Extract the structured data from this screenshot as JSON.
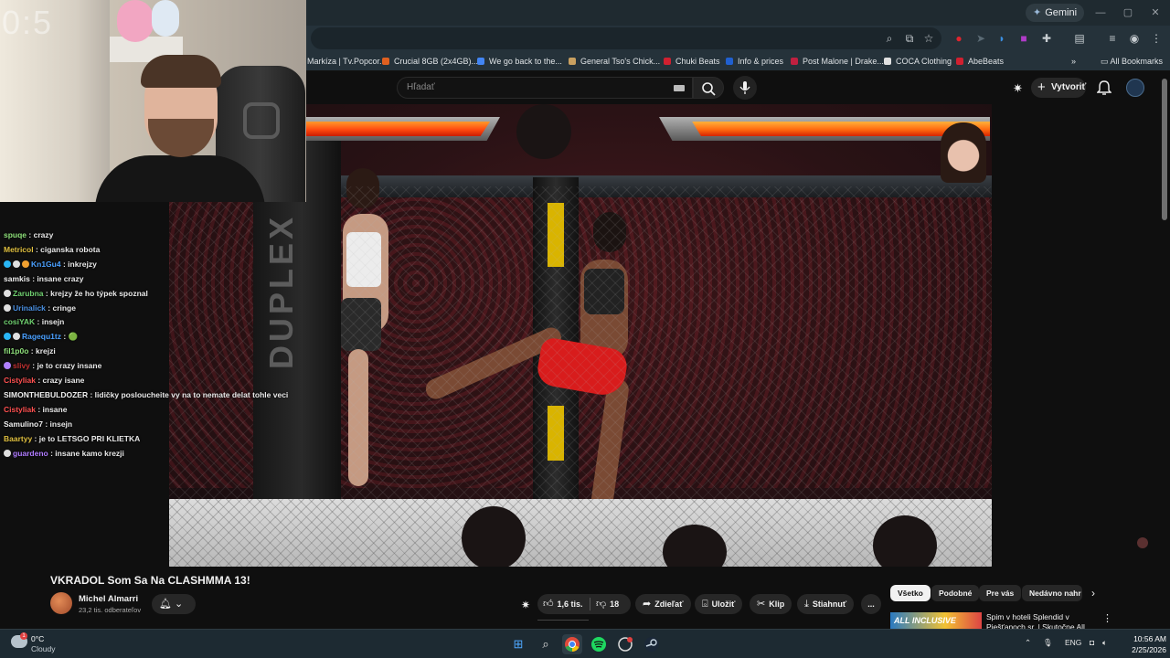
{
  "browser": {
    "gemini_label": "Gemini",
    "bookmarks": [
      {
        "label": "Markíza | Tv.Popcor...",
        "color": "#e0a000"
      },
      {
        "label": "Crucial 8GB (2x4GB)...",
        "color": "#e06020"
      },
      {
        "label": "We go back to the...",
        "color": "#4285f4"
      },
      {
        "label": "General Tso's Chick...",
        "color": "#c9a060"
      },
      {
        "label": "Chuki Beats",
        "color": "#d02030"
      },
      {
        "label": "Info & prices",
        "color": "#2060d0"
      },
      {
        "label": "Post Malone | Drake...",
        "color": "#c02040"
      },
      {
        "label": "COCA Clothing",
        "color": "#222222"
      },
      {
        "label": "AbeBeats",
        "color": "#d02030"
      }
    ],
    "all_bookmarks_label": "All Bookmarks"
  },
  "youtube": {
    "search_placeholder": "Hľadať",
    "create_label": "Vytvoriť",
    "video": {
      "title": "VKRADOL Som Sa Na CLASHMMA 13!",
      "channel": "Michel Almarri",
      "subscribers": "23,2 tis. odberateľov",
      "likes": "1,6 tis.",
      "dislikes": "18",
      "share_label": "Zdieľať",
      "save_label": "Uložiť",
      "clip_label": "Klip",
      "download_label": "Stiahnuť",
      "more_label": "..."
    },
    "chips": [
      {
        "label": "Všetko",
        "active": true
      },
      {
        "label": "Podobné",
        "active": false
      },
      {
        "label": "Pre vás",
        "active": false
      },
      {
        "label": "Nedávno nahr",
        "active": false
      }
    ],
    "recommendation": {
      "thumb_text": "ALL INCLUSIVE",
      "title": "Spim v hoteli Splendid v Piešťanoch sr. | Skutočne All"
    },
    "overlay": {
      "hp_left": 0.97,
      "hp_right": 0.9,
      "pillar_text": "DUPLEX"
    }
  },
  "webcam": {
    "timer": "0:5"
  },
  "chat": [
    {
      "user": "spuqe",
      "color": "#8ee07a",
      "message": "crazy",
      "badges": []
    },
    {
      "user": "Metricol",
      "color": "#e0c040",
      "message": "ciganska robota",
      "badges": []
    },
    {
      "user": "Kn1Gu4",
      "color": "#4aa0ff",
      "message": "inkrejzy",
      "badges": [
        "#29b6f6",
        "#e0e0e0",
        "#f0a030"
      ]
    },
    {
      "user": "samkis",
      "color": "#f0f0f0",
      "message": "insane crazy",
      "badges": []
    },
    {
      "user": "Zarubna",
      "color": "#70d070",
      "message": "krejzy že ho týpek spoznal",
      "badges": [
        "#e0e0e0"
      ]
    },
    {
      "user": "Urinalick",
      "color": "#4a90e2",
      "message": "cringe",
      "badges": [
        "#e0e0e0"
      ]
    },
    {
      "user": "cosiYAK",
      "color": "#70d070",
      "message": "insejn",
      "badges": []
    },
    {
      "user": "Ragequ1tz",
      "color": "#4aa0ff",
      "message": "🟢",
      "badges": [
        "#29b6f6",
        "#e0e0e0"
      ]
    },
    {
      "user": "fil1p0o",
      "color": "#8ee07a",
      "message": "krejzi",
      "badges": []
    },
    {
      "user": "slivy",
      "color": "#c03030",
      "message": "je to crazy insane",
      "badges": [
        "#b080ff"
      ]
    },
    {
      "user": "Cistyliak",
      "color": "#ff5050",
      "message": "crazy isane",
      "badges": []
    },
    {
      "user": "SIMONTHEBULDOZER",
      "color": "#f0f0f0",
      "message": "lidičky posloucheite vy na to nemate delat tohle veci",
      "badges": []
    },
    {
      "user": "Cistyliak",
      "color": "#ff5050",
      "message": "insane",
      "badges": []
    },
    {
      "user": "Samulino7",
      "color": "#f0f0f0",
      "message": "insejn",
      "badges": []
    },
    {
      "user": "Baartyy",
      "color": "#e0c040",
      "message": "je to LETSGO PRI KLIETKA",
      "badges": []
    },
    {
      "user": "guardeno",
      "color": "#b07cff",
      "message": "insane kamo krezji",
      "badges": [
        "#e0e0e0"
      ]
    }
  ],
  "taskbar": {
    "temperature": "0°C",
    "condition": "Cloudy",
    "weather_badge": "1",
    "language": "ENG",
    "time": "10:56 AM",
    "date": "2/25/2026"
  }
}
